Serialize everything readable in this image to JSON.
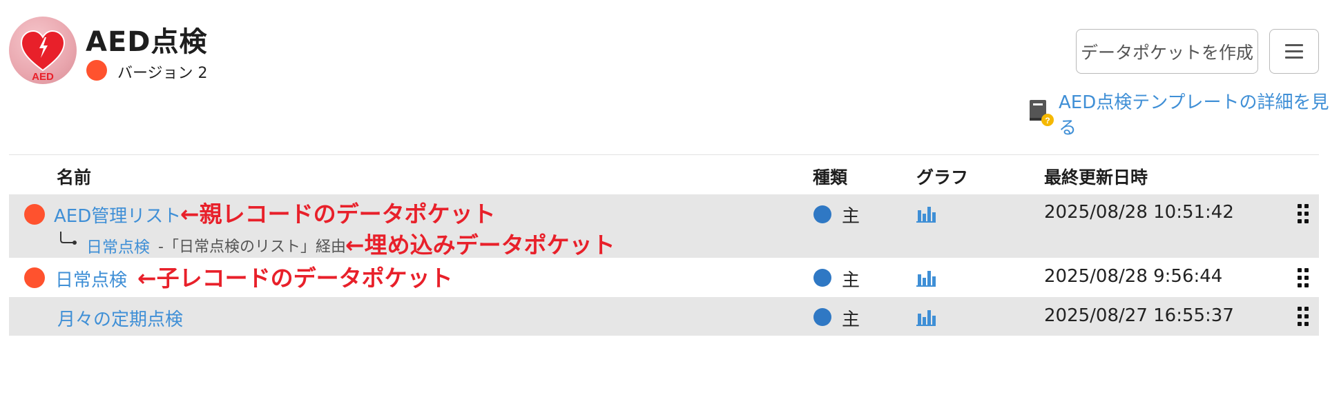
{
  "app": {
    "title": "AED点検",
    "logo_text": "AED",
    "version_label": "バージョン 2",
    "version_color": "#ff522e"
  },
  "header": {
    "create_button_label": "データポケットを作成",
    "menu_icon": "hamburger-icon",
    "template_link_label": "AED点検テンプレートの詳細を見る",
    "template_icon": "book-help-icon"
  },
  "table": {
    "columns": [
      "名前",
      "種類",
      "グラフ",
      "最終更新日時"
    ],
    "rows": [
      {
        "name": "AED管理リスト",
        "has_dot": true,
        "annotation": "←親レコードのデータポケット",
        "sub_name": "日常点検",
        "sub_via": "-「日常点検のリスト」経由",
        "sub_annotation": "←埋め込みデータポケット",
        "type": "主",
        "updated": "2025/08/28 10:51:42"
      },
      {
        "name": "日常点検",
        "has_dot": true,
        "annotation": "←子レコードのデータポケット",
        "type": "主",
        "updated": "2025/08/28 9:56:44"
      },
      {
        "name": "月々の定期点検",
        "has_dot": false,
        "type": "主",
        "updated": "2025/08/27 16:55:37"
      }
    ]
  },
  "colors": {
    "accent_link": "#3f8fd6",
    "status_dot": "#ff522e",
    "type_dot": "#2f78c4",
    "annotation": "#e8202a",
    "row_gray": "#e6e6e6"
  }
}
